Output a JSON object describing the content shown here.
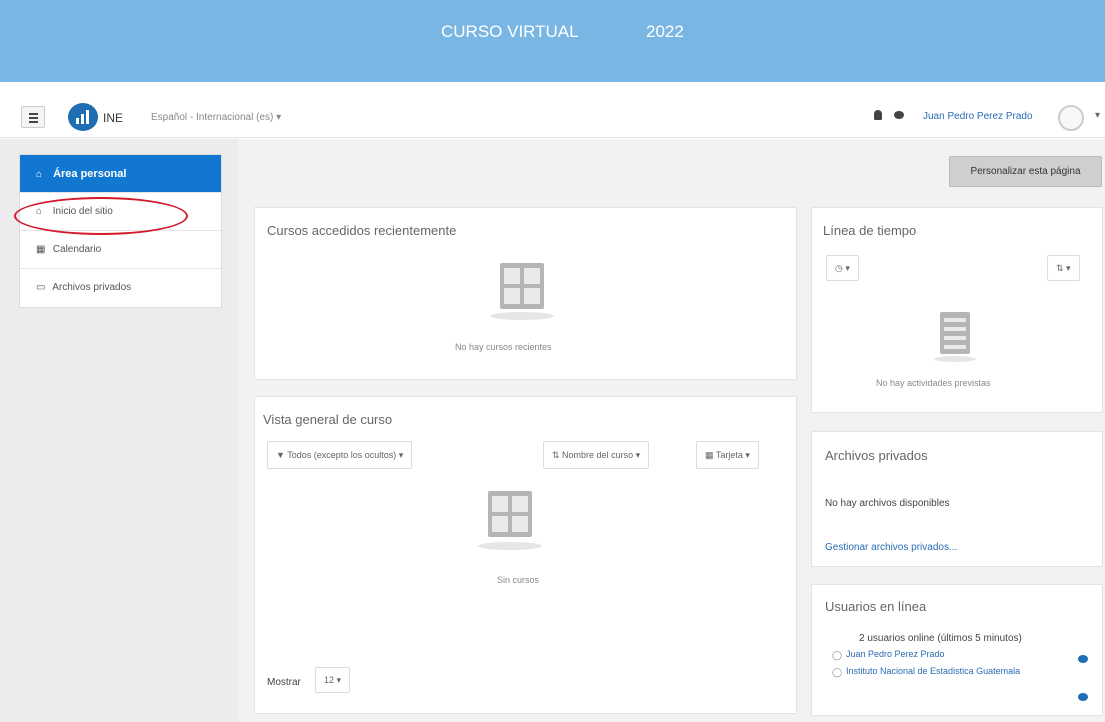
{
  "banner": {
    "title": "CURSO VIRTUAL",
    "year": "2022"
  },
  "navbar": {
    "brand": "INE",
    "language": "Español - Internacional (es) ▾",
    "user_name": "Juan Pedro Perez Prado",
    "caret": "▾",
    "icons": [
      "menu-icon",
      "logo-icon",
      "bell-icon",
      "chat-icon",
      "avatar-icon"
    ]
  },
  "sidebar": {
    "items": [
      {
        "label": "Área personal",
        "icon": "dashboard-icon",
        "glyph": "⌂",
        "active": true
      },
      {
        "label": "Inicio del sitio",
        "icon": "home-icon",
        "glyph": "⌂",
        "active": false
      },
      {
        "label": "Calendario",
        "icon": "calendar-icon",
        "glyph": "▦",
        "active": false
      },
      {
        "label": "Archivos privados",
        "icon": "file-icon",
        "glyph": "▭",
        "active": false
      }
    ]
  },
  "main": {
    "customize_button": "Personalizar esta página",
    "recent": {
      "title": "Cursos accedidos recientemente",
      "empty": "No hay cursos recientes"
    },
    "overview": {
      "title": "Vista general de curso",
      "filter": "▼ Todos (excepto los ocultos) ▾",
      "sort": "⇅ Nombre del curso ▾",
      "view": "▦ Tarjeta ▾",
      "empty": "Sin cursos",
      "show_label": "Mostrar",
      "show_value": "12 ▾"
    }
  },
  "right": {
    "timeline": {
      "title": "Línea de tiempo",
      "clock_filter": "◷ ▾",
      "sort_filter": "⇅ ▾",
      "empty": "No hay actividades previstas"
    },
    "files": {
      "title": "Archivos privados",
      "empty": "No hay archivos disponibles",
      "manage": "Gestionar archivos privados..."
    },
    "online": {
      "title": "Usuarios en línea",
      "summary": "2 usuarios online (últimos 5 minutos)",
      "users": [
        "Juan Pedro Perez Prado",
        "Instituto Nacional de Estadistica Guatemala"
      ]
    }
  },
  "colors": {
    "banner": "#7ab6e3",
    "accent": "#1177d1",
    "link": "#2b6cb3",
    "highlight": "#d21c2c"
  }
}
